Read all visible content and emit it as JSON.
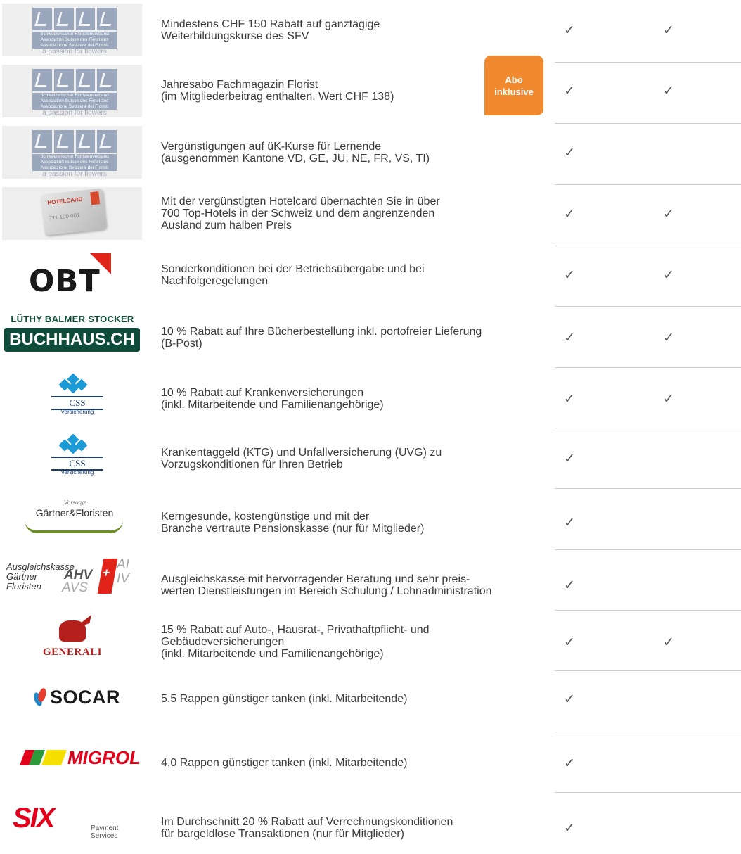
{
  "rows": [
    {
      "logo": "sfv",
      "logo_text": [
        "Schweizerischer Floristenverband",
        "Association Suisse des Fleuristes",
        "Associazione Svizzera dei Fioristi",
        "a passion for flowers"
      ],
      "lines": [
        "Mindestens CHF 150 Rabatt auf ganztägige",
        "Weiterbildungskurse des SFV"
      ],
      "check1": "✓",
      "check2": "✓"
    },
    {
      "logo": "sfv",
      "logo_text": [
        "Schweizerischer Floristenverband",
        "Association Suisse des Fleuristes",
        "Associazione Svizzera dei Fioristi",
        "a passion for flowers"
      ],
      "lines": [
        "Jahresabo Fachmagazin Florist",
        "(im Mitgliederbeitrag enthalten. Wert CHF 138)"
      ],
      "check1": "✓",
      "check2": "✓"
    },
    {
      "logo": "sfv",
      "logo_text": [
        "Schweizerischer Floristenverband",
        "Association Suisse des Fleuristes",
        "Associazione Svizzera dei Fioristi",
        "a passion for flowers"
      ],
      "lines": [
        "Vergünstigungen auf üK-Kurse für Lernende",
        "(ausgenommen Kantone VD, GE, JU, NE, FR, VS, TI)"
      ],
      "check1": "✓",
      "check2": ""
    },
    {
      "logo": "hotelcard",
      "logo_text": [
        "HOTELCARD",
        "711 100 001"
      ],
      "lines": [
        "Mit der vergünstigten Hotelcard übernachten Sie in über",
        "700 Top-Hotels in der Schweiz und dem angrenzenden",
        "Ausland zum halben Preis"
      ],
      "check1": "✓",
      "check2": "✓"
    },
    {
      "logo": "obt",
      "logo_text": [
        "OBT"
      ],
      "lines": [
        "Sonderkonditionen bei der Betriebsübergabe und bei",
        "Nachfolgeregelungen"
      ],
      "check1": "✓",
      "check2": "✓"
    },
    {
      "logo": "buchhaus",
      "logo_text": [
        "LÜTHY BALMER STOCKER",
        "BUCHHAUS.CH"
      ],
      "lines": [
        "10 % Rabatt auf Ihre Bücherbestellung inkl. portofreier Lieferung",
        "(B-Post)"
      ],
      "check1": "✓",
      "check2": "✓"
    },
    {
      "logo": "css",
      "logo_text": [
        "CSS",
        "Versicherung"
      ],
      "lines": [
        "10 % Rabatt auf Krankenversicherungen",
        "(inkl. Mitarbeitende und Familienangehörige)"
      ],
      "check1": "✓",
      "check2": "✓"
    },
    {
      "logo": "css",
      "logo_text": [
        "CSS",
        "Versicherung"
      ],
      "lines": [
        "Krankentaggeld (KTG) und Unfallversicherung (UVG) zu",
        "Vorzugskonditionen für Ihren Betrieb"
      ],
      "check1": "✓",
      "check2": ""
    },
    {
      "logo": "gf",
      "logo_text": [
        "Vorsorge",
        "Gärtner&Floristen"
      ],
      "lines": [
        "Kerngesunde, kostengünstige und mit der",
        "Branche vertraute Pensionskasse (nur für Mitglieder)"
      ],
      "check1": "✓",
      "check2": ""
    },
    {
      "logo": "ak",
      "logo_text": [
        "Ausgleichskasse",
        "Gärtner",
        "Floristen",
        "AHV",
        "AVS",
        "AI",
        "IV"
      ],
      "lines": [
        "Ausgleichskasse mit hervorragender Beratung und sehr preis-",
        "werten Dienstleistungen im Bereich Schulung / Lohnadministration"
      ],
      "check1": "✓",
      "check2": ""
    },
    {
      "logo": "generali",
      "logo_text": [
        "GENERALI"
      ],
      "lines": [
        "15 % Rabatt auf Auto-, Hausrat-, Privathaftpflicht- und",
        "Gebäudeversicherungen",
        "(inkl. Mitarbeitende und Familienangehörige)"
      ],
      "check1": "✓",
      "check2": "✓"
    },
    {
      "logo": "socar",
      "logo_text": [
        "SOCAR"
      ],
      "lines": [
        "5,5 Rappen günstiger tanken (inkl. Mitarbeitende)"
      ],
      "check1": "✓",
      "check2": ""
    },
    {
      "logo": "migrol",
      "logo_text": [
        "MIGROL"
      ],
      "lines": [
        "4,0 Rappen günstiger tanken (inkl. Mitarbeitende)"
      ],
      "check1": "✓",
      "check2": ""
    },
    {
      "logo": "six",
      "logo_text": [
        "SIX",
        "Payment Services"
      ],
      "lines": [
        "Im Durchschnitt 20 % Rabatt auf Verrechnungskonditionen",
        "für bargeldlose Transaktionen (nur für Mitglieder)"
      ],
      "check1": "✓",
      "check2": ""
    }
  ],
  "abo_badge": [
    "Abo",
    "inklusive"
  ],
  "colors": {
    "accent_orange": "#f18a2e",
    "sfv_blue": "#9aa7bd",
    "separator": "#cfcfcf"
  }
}
